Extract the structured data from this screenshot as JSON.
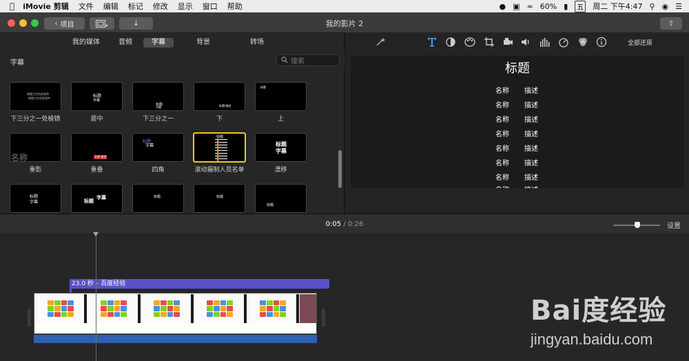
{
  "menubar": {
    "app_name": "iMovie 剪辑",
    "items": [
      "文件",
      "编辑",
      "标记",
      "修改",
      "显示",
      "窗口",
      "帮助"
    ],
    "battery": "60%",
    "input_method": "五",
    "datetime": "周二 下午4:47"
  },
  "window": {
    "title": "我的影片 2",
    "back_label": "项目"
  },
  "browser": {
    "tabs": [
      "我的媒体",
      "音频",
      "字幕",
      "背景",
      "转场"
    ],
    "active_tab": "字幕",
    "section_title": "字幕",
    "search_placeholder": "搜索",
    "thumbnails": [
      {
        "label": "下三分之一处棱镜",
        "preview": [
          "地图工作台的宣传",
          "地图工作台的宣传"
        ]
      },
      {
        "label": "居中",
        "preview": [
          "标题",
          "字幕"
        ]
      },
      {
        "label": "下三分之一",
        "preview": [
          "标题",
          "字幕"
        ]
      },
      {
        "label": "下",
        "preview": [
          "标题/描述"
        ]
      },
      {
        "label": "上",
        "preview": [
          "标题"
        ]
      },
      {
        "label": "重影",
        "preview": [
          "名称"
        ]
      },
      {
        "label": "重叠",
        "preview": [
          "名称 描述"
        ]
      },
      {
        "label": "四角",
        "preview": [
          "标题",
          "字幕"
        ]
      },
      {
        "label": "滚动摄制人员名单",
        "preview": [
          "标题"
        ],
        "selected": true
      },
      {
        "label": "漂移",
        "preview": [
          "标题",
          "字幕"
        ]
      },
      {
        "label": "",
        "preview": [
          "标题",
          "字幕"
        ]
      },
      {
        "label": "",
        "preview": [
          "标题",
          "字幕"
        ]
      },
      {
        "label": "",
        "preview": [
          "标题"
        ]
      },
      {
        "label": "",
        "preview": [
          "标题"
        ]
      },
      {
        "label": "",
        "preview": [
          "标题"
        ]
      }
    ]
  },
  "inspector": {
    "reset_all_label": "全部还原"
  },
  "viewer": {
    "title": "标题",
    "rows": [
      [
        "名称",
        "描述"
      ],
      [
        "名称",
        "描述"
      ],
      [
        "名称",
        "描述"
      ],
      [
        "名称",
        "描述"
      ],
      [
        "名称",
        "描述"
      ],
      [
        "名称",
        "描述"
      ],
      [
        "名称",
        "描述"
      ],
      [
        "名称",
        "描述"
      ]
    ]
  },
  "timeline": {
    "current_time": "0:05",
    "separator": "/",
    "total_time": "0:26",
    "settings_label": "设置",
    "title_clip_label": "23.0 秒 – 百度经验"
  },
  "watermark": {
    "logo": "Bai度经验",
    "url": "jingyan.baidu.com"
  },
  "colors": {
    "accent_selected": "#f0c62e",
    "title_clip": "#5a51c8",
    "audio_bar": "#2f5fb3",
    "toolbar_active_icon": "#4a9eff"
  }
}
